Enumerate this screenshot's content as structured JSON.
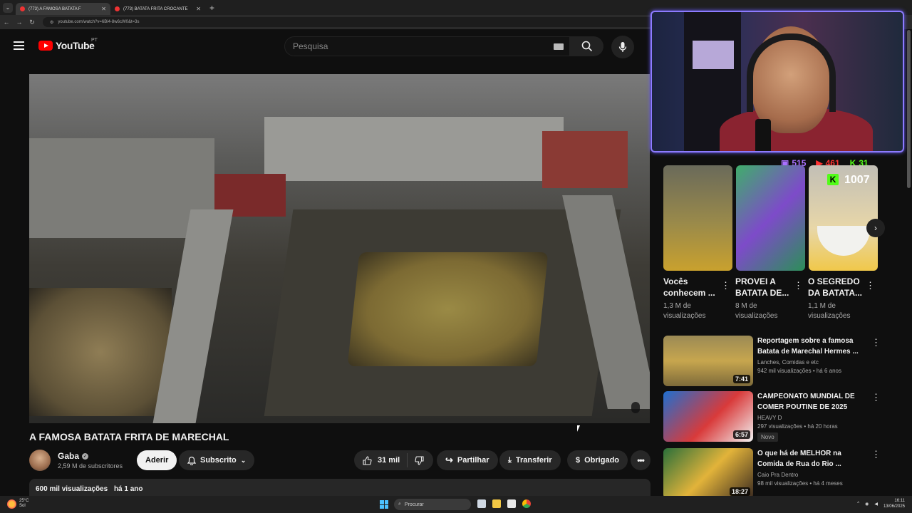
{
  "browser": {
    "tabs": [
      {
        "label": "(773) A FAMOSA BATATA F",
        "active": true
      },
      {
        "label": "(773) BATATA FRITA CROCANTE",
        "active": false
      }
    ],
    "url": "youtube.com/watch?v=6Bi4-8w6cW0&t=3s"
  },
  "youtube": {
    "logo_text": "YouTube",
    "country": "PT",
    "search_placeholder": "Pesquisa"
  },
  "video": {
    "title": "A FAMOSA BATATA FRITA DE MARECHAL",
    "channel": "Gaba",
    "subscribers": "2,59 M de subscritores",
    "join_label": "Aderir",
    "subscribe_label": "Subscrito",
    "likes": "31 mil",
    "share_label": "Partilhar",
    "download_label": "Transferir",
    "thanks_label": "Obrigado",
    "views": "600 mil visualizações",
    "age": "há 1 ano"
  },
  "overlay": {
    "twitch_count": "515",
    "youtube_count": "461",
    "kick_count": "31",
    "total_count": "1007"
  },
  "shorts": [
    {
      "title": "Vocês conhecem ...",
      "views": "1,3 M de visualizações"
    },
    {
      "title": "PROVEI A BATATA DE...",
      "views": "8 M de visualizações"
    },
    {
      "title": "O SEGREDO DA BATATA...",
      "views": "1,1 M de visualizações"
    }
  ],
  "recommendations": [
    {
      "title": "Reportagem sobre a famosa Batata de Marechal Hermes ...",
      "channel": "Lanches, Comidas e etc",
      "meta": "942 mil visualizações • há 6 anos",
      "duration": "7:41",
      "badge": ""
    },
    {
      "title": "CAMPEONATO MUNDIAL DE COMER POUTINE DE 2025",
      "channel": "HEAVY D",
      "meta": "297 visualizações • há 20 horas",
      "duration": "6:57",
      "badge": "Novo"
    },
    {
      "title": "O que há de MELHOR na Comida de Rua do Rio ...",
      "channel": "Caio Pra Dentro",
      "meta": "98 mil visualizações • há 4 meses",
      "duration": "18:27",
      "badge": ""
    }
  ],
  "taskbar": {
    "search_placeholder": "Procurar",
    "weather_temp": "25°C",
    "weather_desc": "Sol",
    "time": "16:11",
    "date": "13/06/2025"
  }
}
